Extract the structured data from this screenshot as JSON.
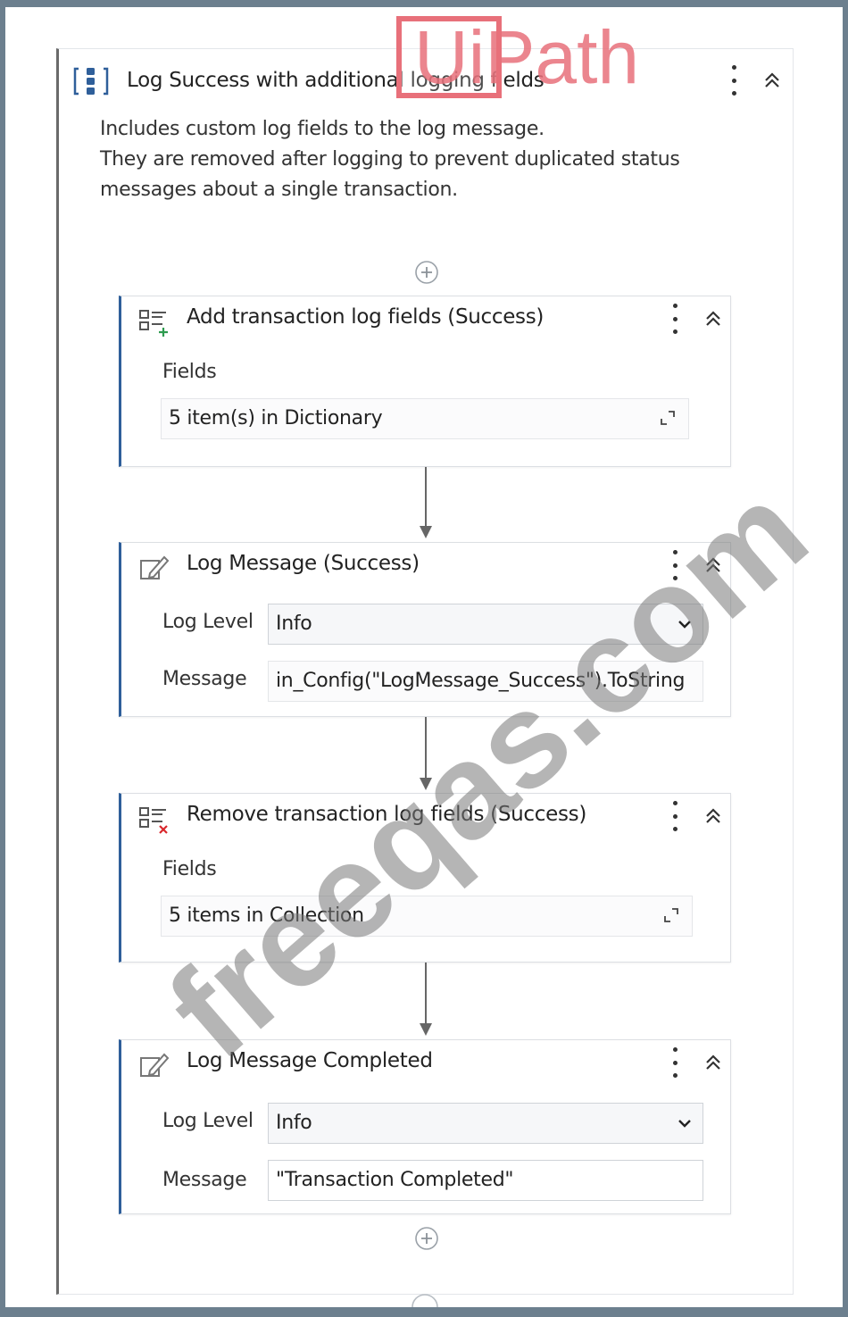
{
  "logo": {
    "text": "UiPath"
  },
  "watermark": {
    "text": "freeqas.com"
  },
  "sequence": {
    "title": "Log Success with additional logging fields",
    "description": [
      "Includes custom log fields to the log message.",
      "They are removed after logging to prevent duplicated status",
      "messages about a single transaction."
    ],
    "icon": "sequence-icon"
  },
  "activities": [
    {
      "title": "Add transaction log fields (Success)",
      "icon": "add-log-fields-icon",
      "field_label": "Fields",
      "field_value": "5 item(s) in Dictionary"
    },
    {
      "title": "Log Message (Success)",
      "icon": "log-message-icon",
      "level_label": "Log Level",
      "level_value": "Info",
      "message_label": "Message",
      "message_value": "in_Config(\"LogMessage_Success\").ToString"
    },
    {
      "title": "Remove transaction log fields (Success)",
      "icon": "remove-log-fields-icon",
      "field_label": "Fields",
      "field_value": "5 items in Collection"
    },
    {
      "title": "Log Message Completed",
      "icon": "log-message-icon",
      "level_label": "Log Level",
      "level_value": "Info",
      "message_label": "Message",
      "message_value": "\"Transaction Completed\""
    }
  ],
  "colors": {
    "frame": "#6c7f8e",
    "activity_accent": "#2f5f9a",
    "sequence_accent": "#6a6a6a",
    "logo": "#e8707a",
    "remove_x": "#d9262b",
    "add_plus": "#2e9b4f"
  }
}
